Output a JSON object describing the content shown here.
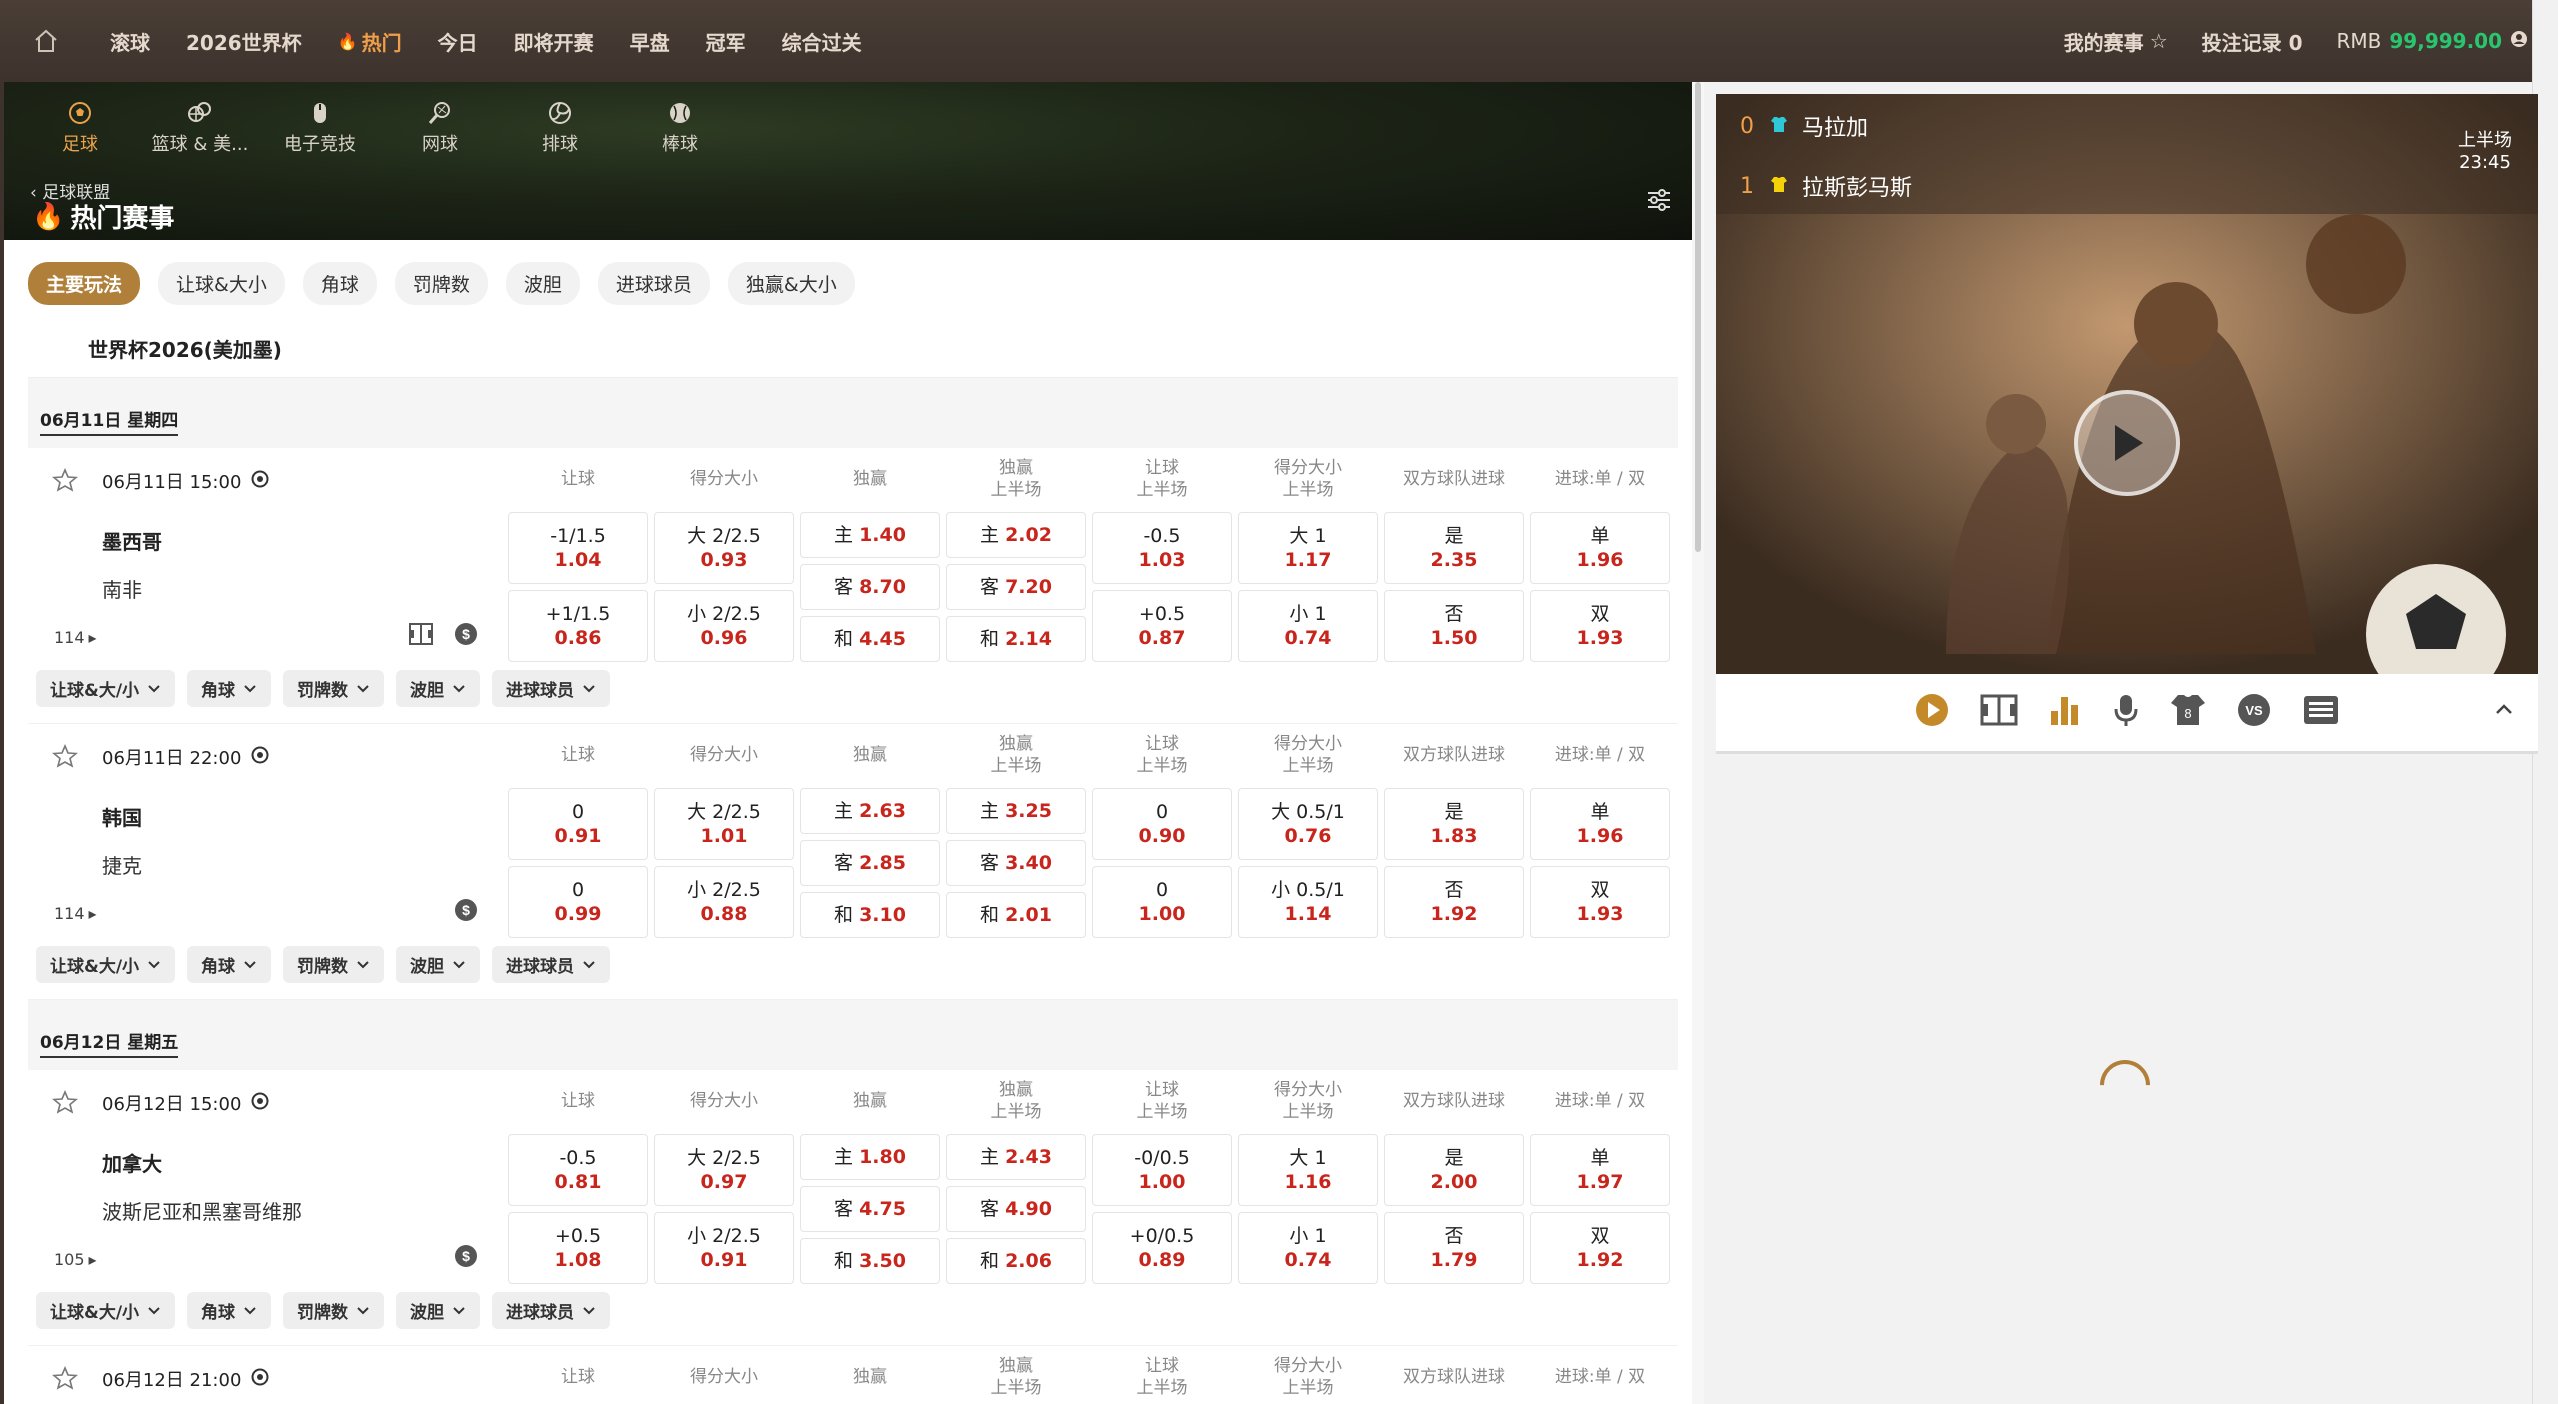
{
  "topbar": {
    "nav": [
      {
        "label": "滚球",
        "active": false
      },
      {
        "label": "2026世界杯",
        "active": false
      },
      {
        "label": "热门",
        "active": true
      },
      {
        "label": "今日",
        "active": false
      },
      {
        "label": "即将开赛",
        "active": false
      },
      {
        "label": "早盘",
        "active": false
      },
      {
        "label": "冠军",
        "active": false
      },
      {
        "label": "综合过关",
        "active": false
      }
    ],
    "my_matches": "我的赛事",
    "bet_record": "投注记录 0",
    "currency": "RMB",
    "balance": "99,999.00",
    "balance_color": "#28c76f"
  },
  "sports": [
    {
      "label": "足球",
      "icon": "soccer-ball-icon",
      "active": true
    },
    {
      "label": "篮球 & 美...",
      "icon": "basketball-icon",
      "active": false
    },
    {
      "label": "电子竞技",
      "icon": "mouse-icon",
      "active": false
    },
    {
      "label": "网球",
      "icon": "tennis-racket-icon",
      "active": false
    },
    {
      "label": "排球",
      "icon": "volleyball-icon",
      "active": false
    },
    {
      "label": "棒球",
      "icon": "baseball-icon",
      "active": false
    }
  ],
  "breadcrumb": "足球联盟",
  "page_title": "热门赛事",
  "market_tabs": [
    {
      "label": "主要玩法",
      "active": true
    },
    {
      "label": "让球&大小",
      "active": false
    },
    {
      "label": "角球",
      "active": false
    },
    {
      "label": "罚牌数",
      "active": false
    },
    {
      "label": "波胆",
      "active": false
    },
    {
      "label": "进球球员",
      "active": false
    },
    {
      "label": "独赢&大小",
      "active": false
    }
  ],
  "league": "世界杯2026(美加墨)",
  "columns": [
    {
      "l1": "让球",
      "l2": ""
    },
    {
      "l1": "得分大小",
      "l2": ""
    },
    {
      "l1": "独赢",
      "l2": ""
    },
    {
      "l1": "独赢",
      "l2": "上半场"
    },
    {
      "l1": "让球",
      "l2": "上半场"
    },
    {
      "l1": "得分大小",
      "l2": "上半场"
    },
    {
      "l1": "双方球队进球",
      "l2": ""
    },
    {
      "l1": "进球:单 / 双",
      "l2": ""
    }
  ],
  "pills": [
    "让球&大/小",
    "角球",
    "罚牌数",
    "波胆",
    "进球球员"
  ],
  "dates": [
    "06月11日 星期四",
    "06月12日 星期五"
  ],
  "matches": [
    {
      "time": "06月11日 15:00",
      "home": "墨西哥",
      "away": "南非",
      "more": "114",
      "has_field_icon": true,
      "hcp": [
        {
          "l": "-1/1.5",
          "o": "1.04"
        },
        {
          "l": "+1/1.5",
          "o": "0.86"
        }
      ],
      "ou": [
        {
          "l": "大 2/2.5",
          "o": "0.93"
        },
        {
          "l": "小 2/2.5",
          "o": "0.96"
        }
      ],
      "win": [
        {
          "l": "主",
          "o": "1.40"
        },
        {
          "l": "客",
          "o": "8.70"
        },
        {
          "l": "和",
          "o": "4.45"
        }
      ],
      "win_h1": [
        {
          "l": "主",
          "o": "2.02"
        },
        {
          "l": "客",
          "o": "7.20"
        },
        {
          "l": "和",
          "o": "2.14"
        }
      ],
      "hcp_h1": [
        {
          "l": "-0.5",
          "o": "1.03"
        },
        {
          "l": "+0.5",
          "o": "0.87"
        }
      ],
      "ou_h1": [
        {
          "l": "大 1",
          "o": "1.17"
        },
        {
          "l": "小 1",
          "o": "0.74"
        }
      ],
      "btts": [
        {
          "l": "是",
          "o": "2.35"
        },
        {
          "l": "否",
          "o": "1.50"
        }
      ],
      "oddeven": [
        {
          "l": "单",
          "o": "1.96"
        },
        {
          "l": "双",
          "o": "1.93"
        }
      ]
    },
    {
      "time": "06月11日 22:00",
      "home": "韩国",
      "away": "捷克",
      "more": "114",
      "has_field_icon": false,
      "hcp": [
        {
          "l": "0",
          "o": "0.91"
        },
        {
          "l": "0",
          "o": "0.99"
        }
      ],
      "ou": [
        {
          "l": "大 2/2.5",
          "o": "1.01"
        },
        {
          "l": "小 2/2.5",
          "o": "0.88"
        }
      ],
      "win": [
        {
          "l": "主",
          "o": "2.63"
        },
        {
          "l": "客",
          "o": "2.85"
        },
        {
          "l": "和",
          "o": "3.10"
        }
      ],
      "win_h1": [
        {
          "l": "主",
          "o": "3.25"
        },
        {
          "l": "客",
          "o": "3.40"
        },
        {
          "l": "和",
          "o": "2.01"
        }
      ],
      "hcp_h1": [
        {
          "l": "0",
          "o": "0.90"
        },
        {
          "l": "0",
          "o": "1.00"
        }
      ],
      "ou_h1": [
        {
          "l": "大 0.5/1",
          "o": "0.76"
        },
        {
          "l": "小 0.5/1",
          "o": "1.14"
        }
      ],
      "btts": [
        {
          "l": "是",
          "o": "1.83"
        },
        {
          "l": "否",
          "o": "1.92"
        }
      ],
      "oddeven": [
        {
          "l": "单",
          "o": "1.96"
        },
        {
          "l": "双",
          "o": "1.93"
        }
      ]
    },
    {
      "time": "06月12日 15:00",
      "home": "加拿大",
      "away": "波斯尼亚和黑塞哥维那",
      "more": "105",
      "has_field_icon": false,
      "hcp": [
        {
          "l": "-0.5",
          "o": "0.81"
        },
        {
          "l": "+0.5",
          "o": "1.08"
        }
      ],
      "ou": [
        {
          "l": "大 2/2.5",
          "o": "0.97"
        },
        {
          "l": "小 2/2.5",
          "o": "0.91"
        }
      ],
      "win": [
        {
          "l": "主",
          "o": "1.80"
        },
        {
          "l": "客",
          "o": "4.75"
        },
        {
          "l": "和",
          "o": "3.50"
        }
      ],
      "win_h1": [
        {
          "l": "主",
          "o": "2.43"
        },
        {
          "l": "客",
          "o": "4.90"
        },
        {
          "l": "和",
          "o": "2.06"
        }
      ],
      "hcp_h1": [
        {
          "l": "-0/0.5",
          "o": "1.00"
        },
        {
          "l": "+0/0.5",
          "o": "0.89"
        }
      ],
      "ou_h1": [
        {
          "l": "大 1",
          "o": "1.16"
        },
        {
          "l": "小 1",
          "o": "0.74"
        }
      ],
      "btts": [
        {
          "l": "是",
          "o": "2.00"
        },
        {
          "l": "否",
          "o": "1.79"
        }
      ],
      "oddeven": [
        {
          "l": "单",
          "o": "1.97"
        },
        {
          "l": "双",
          "o": "1.92"
        }
      ]
    },
    {
      "time": "06月12日 21:00"
    }
  ],
  "live": {
    "home_score": "0",
    "home": "马拉加",
    "home_shirt_color": "#2ec8d6",
    "away_score": "1",
    "away": "拉斯彭马斯",
    "away_shirt_color": "#f5d10a",
    "period": "上半场",
    "clock": "23:45"
  },
  "colors": {
    "accent": "#b0803b",
    "odds": "#c8251c",
    "topbar": "#3d322c"
  }
}
